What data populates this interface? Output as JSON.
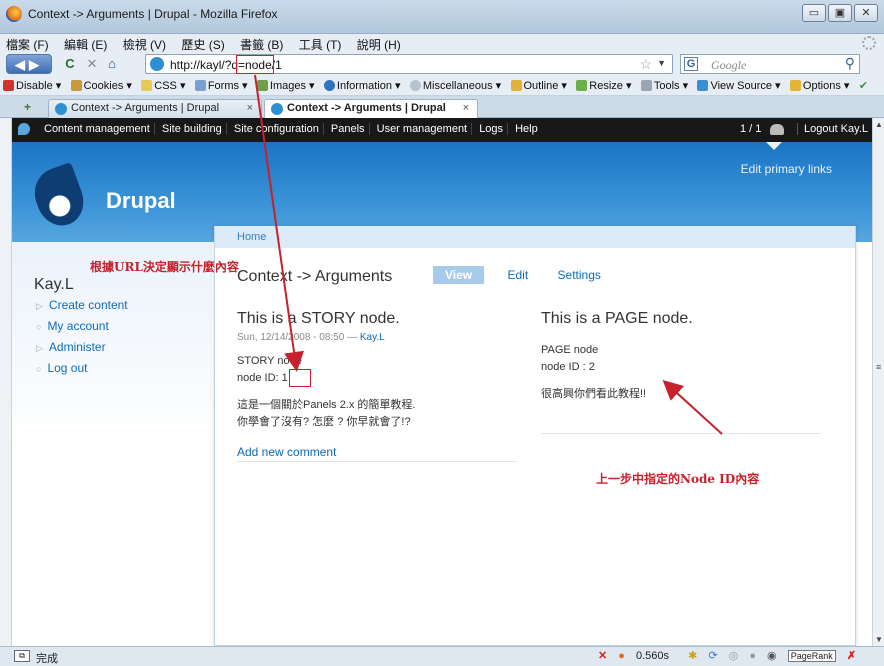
{
  "window": {
    "title": "Context -> Arguments | Drupal - Mozilla Firefox",
    "buttons": [
      "▭",
      "▣",
      "✕"
    ]
  },
  "menubar": [
    "檔案 (F)",
    "編輯 (E)",
    "檢視 (V)",
    "歷史 (S)",
    "書籤 (B)",
    "工具 (T)",
    "說明 (H)"
  ],
  "navbar": {
    "back_forward": "◀▶",
    "reload": "C",
    "stop": "✕",
    "home": "⌂",
    "url": "http://kayl/?q=node/1",
    "search_placeholder": "Google"
  },
  "toolbar": [
    "Disable ▾",
    "Cookies ▾",
    "CSS ▾",
    "Forms ▾",
    "Images ▾",
    "Information ▾",
    "Miscellaneous ▾",
    "Outline ▾",
    "Resize ▾",
    "Tools ▾",
    "View Source ▾",
    "Options ▾"
  ],
  "tabs": [
    {
      "label": "Context -> Arguments | Drupal",
      "close": "×"
    },
    {
      "label": "Context -> Arguments | Drupal",
      "close": "×"
    }
  ],
  "adminbar": {
    "items": [
      "Content management",
      "Site building",
      "Site configuration",
      "Panels",
      "User management",
      "Logs",
      "Help"
    ],
    "count": "1 / 1",
    "logout": "Logout Kay.L"
  },
  "header": {
    "site_name": "Drupal",
    "primary_links": "Edit primary links"
  },
  "sidebar": {
    "user": "Kay.L",
    "links": [
      "Create content",
      "My account",
      "Administer",
      "Log out"
    ]
  },
  "main": {
    "breadcrumb": "Home",
    "title": "Context -> Arguments",
    "tabs": [
      "View",
      "Edit",
      "Settings"
    ],
    "left_node": {
      "title": "This is a STORY node.",
      "date": "Sun, 12/14/2008 - 08:50 — ",
      "author": "Kay.L",
      "line1": "STORY node",
      "line2_prefix": "node ID",
      "line2_value": ": 1",
      "body1": "這是一個關於Panels 2.x 的簡單教程.",
      "body2": "你學會了沒有? 怎麼 ? 你早就會了!?",
      "add_comment": "Add new comment"
    },
    "right_node": {
      "title": "This is a PAGE node.",
      "line1": "PAGE node",
      "line2": "node ID : 2",
      "body": "很高興你們看此教程!!"
    }
  },
  "annotations": {
    "note_url": "根據URL決定顯示什麼內容",
    "note_node": "上一步中指定的Node ID內容",
    "color": "#c8202c"
  },
  "statusbar": {
    "text": "完成",
    "timing": "0.560s",
    "pagerank": "PageRank"
  }
}
